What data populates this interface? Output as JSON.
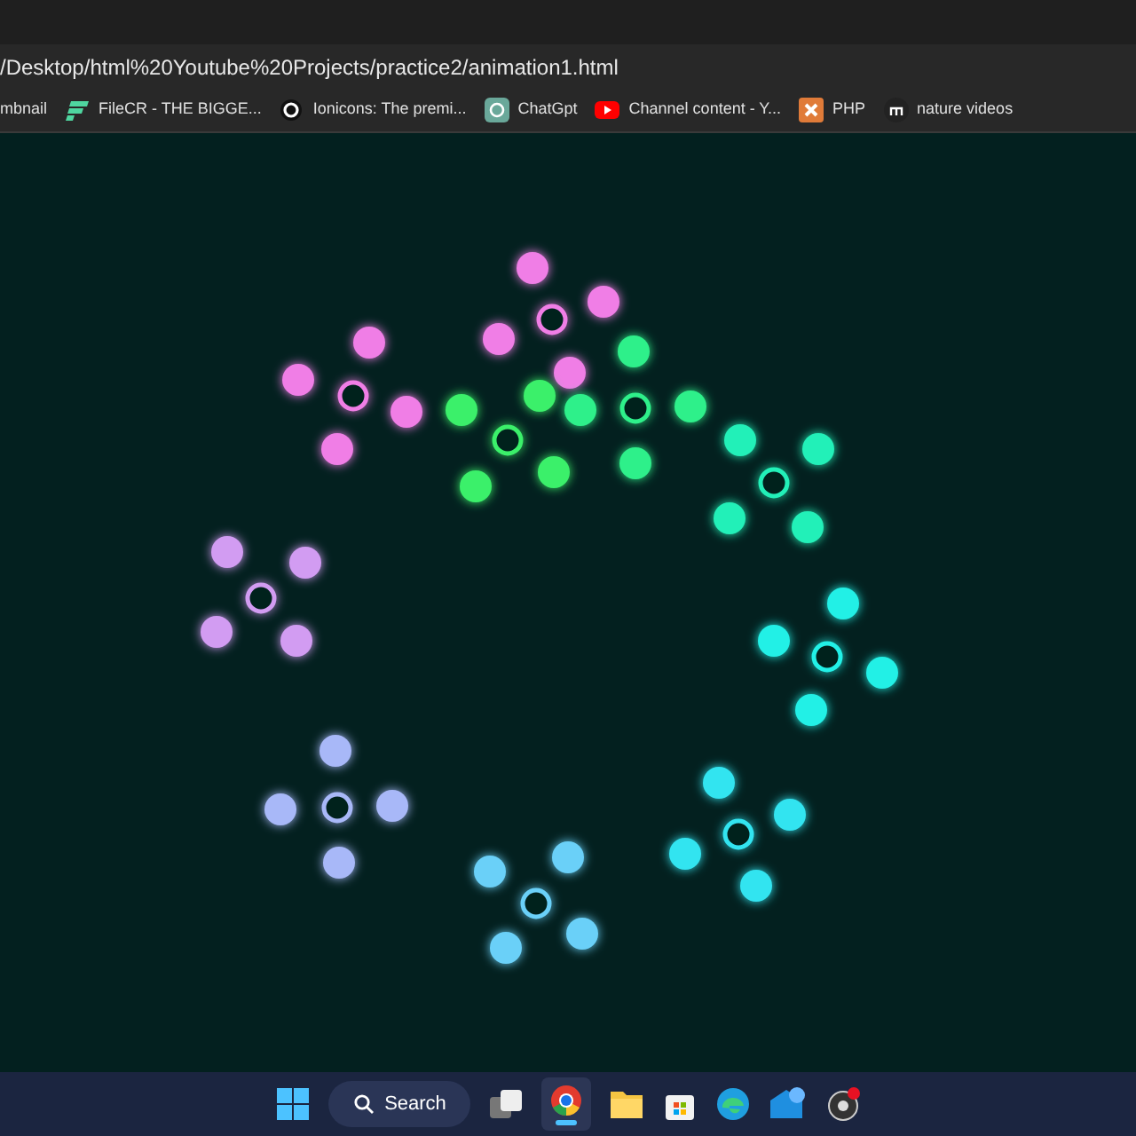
{
  "address_bar": {
    "url": "/Desktop/html%20Youtube%20Projects/practice2/animation1.html"
  },
  "bookmarks": [
    {
      "label": "mbnail"
    },
    {
      "label": "FileCR - THE BIGGE..."
    },
    {
      "label": "Ionicons: The premi..."
    },
    {
      "label": "ChatGpt"
    },
    {
      "label": "Channel content - Y..."
    },
    {
      "label": "PHP"
    },
    {
      "label": "nature videos"
    }
  ],
  "taskbar": {
    "search": "Search"
  }
}
